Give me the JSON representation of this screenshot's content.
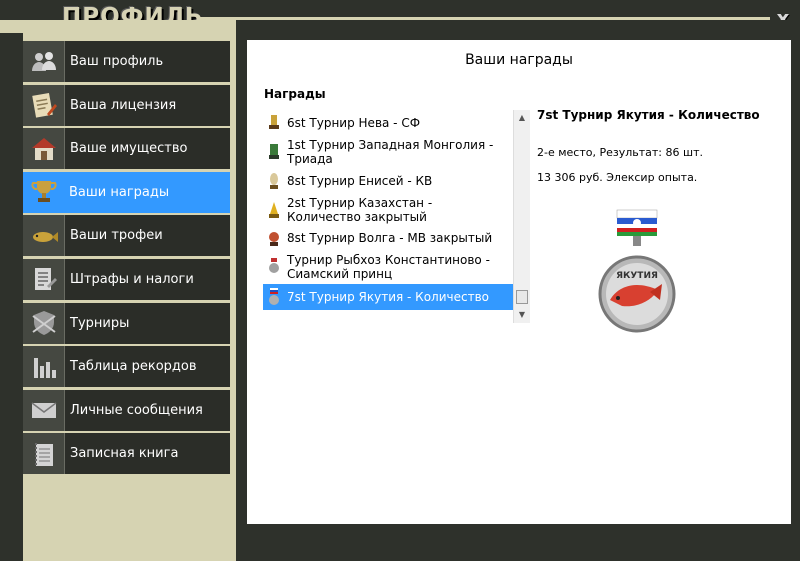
{
  "window": {
    "title": "ПРОФИЛЬ",
    "close_label": "x"
  },
  "sidebar": {
    "items": [
      {
        "label": "Ваш профиль",
        "icon": "users-icon"
      },
      {
        "label": "Ваша лицензия",
        "icon": "license-icon"
      },
      {
        "label": "Ваше имущество",
        "icon": "house-icon"
      },
      {
        "label": "Ваши награды",
        "icon": "trophy-icon",
        "active": true
      },
      {
        "label": "Ваши трофеи",
        "icon": "fish-icon"
      },
      {
        "label": "Штрафы и налоги",
        "icon": "document-icon"
      },
      {
        "label": "Турниры",
        "icon": "shield-icon"
      },
      {
        "label": "Таблица рекордов",
        "icon": "bar-chart-icon"
      },
      {
        "label": "Личные сообщения",
        "icon": "envelope-icon"
      },
      {
        "label": "Записная книга",
        "icon": "notebook-icon"
      }
    ]
  },
  "main": {
    "title": "Ваши награды",
    "awards_header": "Награды",
    "awards": [
      {
        "line1": "6st Турнир Нева - СФ",
        "line2": ""
      },
      {
        "line1": "1st Турнир Западная Монголия -",
        "line2": "Триада"
      },
      {
        "line1": "8st Турнир Енисей - КВ",
        "line2": ""
      },
      {
        "line1": "2st Турнир Казахстан -",
        "line2": "Количество закрытый"
      },
      {
        "line1": "8st Турнир Волга - МВ закрытый",
        "line2": ""
      },
      {
        "line1": "Турнир Рыбхоз Константиново -",
        "line2": "Сиамский принц"
      },
      {
        "line1": "7st Турнир Якутия - Количество",
        "line2": "",
        "selected": true
      }
    ],
    "detail": {
      "title": "7st Турнир Якутия - Количество",
      "result": "2-е место, Результат: 86 шт.",
      "prize": "13 306 руб. Элексир опыта.",
      "medal_text": "ЯКУТИЯ"
    }
  },
  "colors": {
    "accent": "#3399ff",
    "sidebar_bg": "#d6d3b2",
    "frame_bg": "#2e312b"
  }
}
